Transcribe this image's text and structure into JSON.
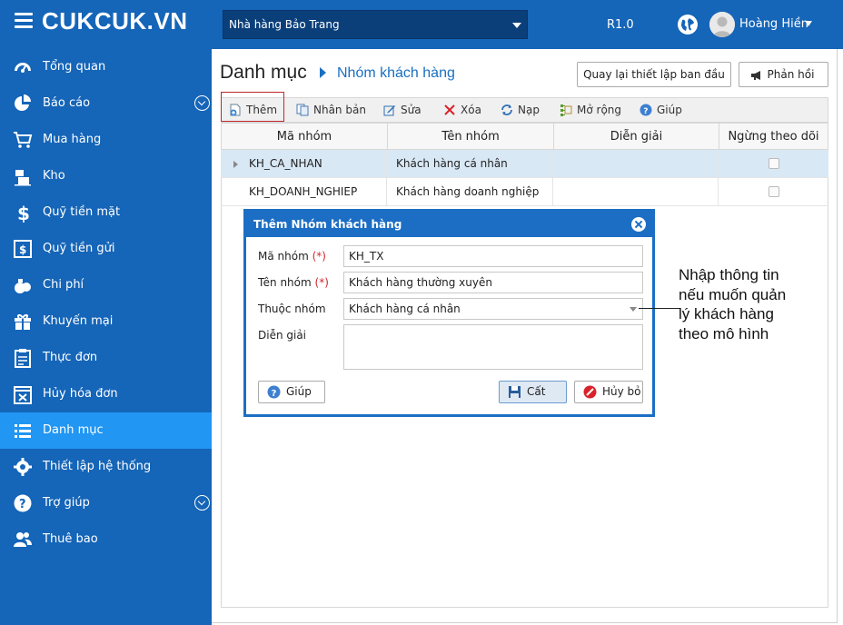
{
  "app": {
    "logo": "CUKCUK.VN",
    "branch": "Nhà hàng Bảo Trang",
    "version": "R1.0",
    "user_name": "Hoàng Hiền"
  },
  "sidebar": {
    "items": [
      {
        "label": "Tổng quan",
        "icon": "dashboard-icon",
        "expandable": false,
        "active": false
      },
      {
        "label": "Báo cáo",
        "icon": "pie-chart-icon",
        "expandable": true,
        "active": false
      },
      {
        "label": "Mua hàng",
        "icon": "cart-icon",
        "expandable": false,
        "active": false
      },
      {
        "label": "Kho",
        "icon": "warehouse-icon",
        "expandable": false,
        "active": false
      },
      {
        "label": "Quỹ tiền mặt",
        "icon": "dollar-icon",
        "expandable": false,
        "active": false
      },
      {
        "label": "Quỹ tiền gửi",
        "icon": "bank-icon",
        "expandable": false,
        "active": false
      },
      {
        "label": "Chi phí",
        "icon": "money-bag-icon",
        "expandable": false,
        "active": false
      },
      {
        "label": "Khuyến mại",
        "icon": "gift-icon",
        "expandable": false,
        "active": false
      },
      {
        "label": "Thực đơn",
        "icon": "clipboard-icon",
        "expandable": false,
        "active": false
      },
      {
        "label": "Hủy hóa đơn",
        "icon": "cancel-invoice-icon",
        "expandable": false,
        "active": false
      },
      {
        "label": "Danh mục",
        "icon": "list-icon",
        "expandable": false,
        "active": true
      },
      {
        "label": "Thiết lập hệ thống",
        "icon": "gear-icon",
        "expandable": false,
        "active": false
      },
      {
        "label": "Trợ giúp",
        "icon": "help-icon",
        "expandable": true,
        "active": false
      },
      {
        "label": "Thuê bao",
        "icon": "users-icon",
        "expandable": false,
        "active": false
      }
    ]
  },
  "page": {
    "title": "Danh mục",
    "subtitle": "Nhóm khách hàng",
    "reset_label": "Quay lại thiết lập ban đầu",
    "feedback_label": "Phản hồi"
  },
  "toolbar": {
    "add": "Thêm",
    "duplicate": "Nhân bản",
    "edit": "Sửa",
    "delete": "Xóa",
    "reload": "Nạp",
    "expand": "Mở rộng",
    "help": "Giúp"
  },
  "table": {
    "columns": [
      "Mã nhóm",
      "Tên nhóm",
      "Diễn giải",
      "Ngừng theo dõi"
    ],
    "rows": [
      {
        "code": "KH_CA_NHAN",
        "name": "Khách hàng cá nhân",
        "description": "",
        "inactive": false
      },
      {
        "code": "KH_DOANH_NGHIEP",
        "name": "Khách hàng doanh nghiệp",
        "description": "",
        "inactive": false
      }
    ]
  },
  "dialog": {
    "title": "Thêm Nhóm khách hàng",
    "code_label": "Mã nhóm",
    "name_label": "Tên nhóm",
    "required_mark": "(*)",
    "parent_label": "Thuộc nhóm",
    "description_label": "Diễn giải",
    "code_value": "KH_TX",
    "name_value": "Khách hàng thường xuyên",
    "parent_value": "Khách hàng cá nhân",
    "description_value": "",
    "help_button": "Giúp",
    "save_button": "Cất",
    "cancel_button": "Hủy bỏ"
  },
  "annotation": {
    "line1": "Nhập thông tin",
    "line2": "nếu muốn quản",
    "line3": "lý khách hàng",
    "line4": "theo mô hình"
  },
  "colors": {
    "primary": "#1565b8",
    "active": "#2196f3",
    "dialog": "#1c6ec4",
    "required": "#d0282e"
  }
}
